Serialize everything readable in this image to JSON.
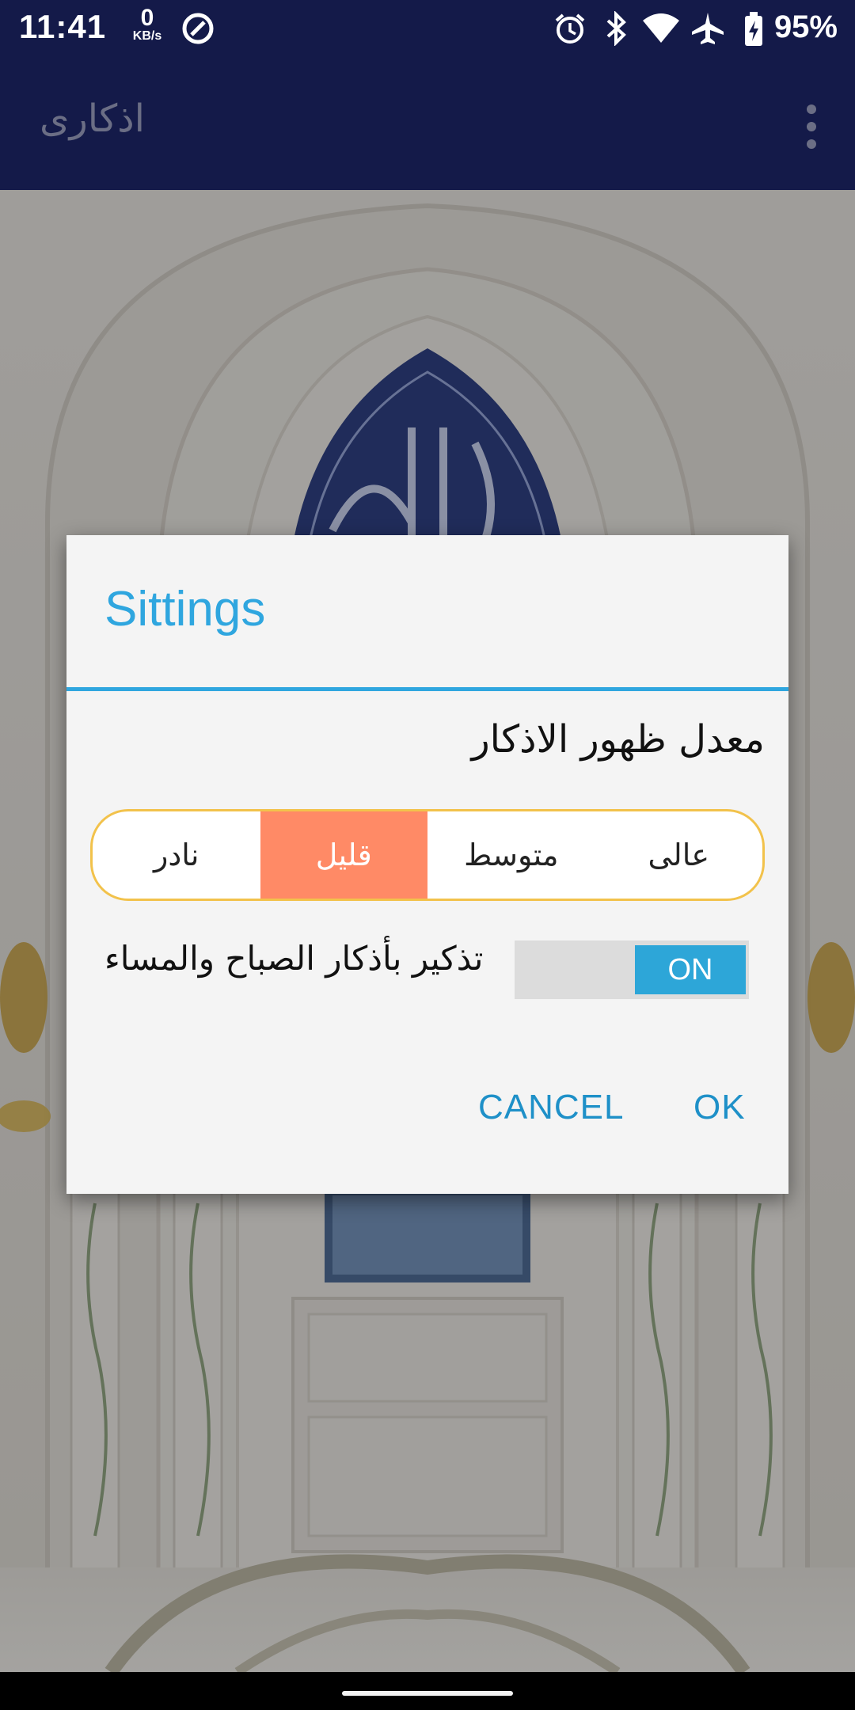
{
  "status_bar": {
    "time": "11:41",
    "net_speed_value": "0",
    "net_speed_unit": "KB/s",
    "battery": "95%",
    "icons": [
      "data-saver-icon",
      "alarm-icon",
      "bluetooth-icon",
      "wifi-icon",
      "airplane-icon",
      "battery-charging-icon"
    ]
  },
  "app_bar": {
    "title": "اذكارى",
    "menu_icon": "more-vert-icon"
  },
  "dialog": {
    "title": "Sittings",
    "frequency_label": "معدل ظهور الاذكار",
    "frequency_options": [
      "نادر",
      "قليل",
      "متوسط",
      "عالى"
    ],
    "frequency_selected": "قليل",
    "reminder_label": "تذكير بأذكار الصباح والمساء",
    "reminder_toggle": "ON",
    "cancel_label": "CANCEL",
    "ok_label": "OK"
  },
  "colors": {
    "accent": "#2fa6df",
    "app_bar": "#141a49",
    "segment_selected": "#ff8a66",
    "segment_border": "#f2c24b",
    "toggle_on": "#2da6d8"
  }
}
